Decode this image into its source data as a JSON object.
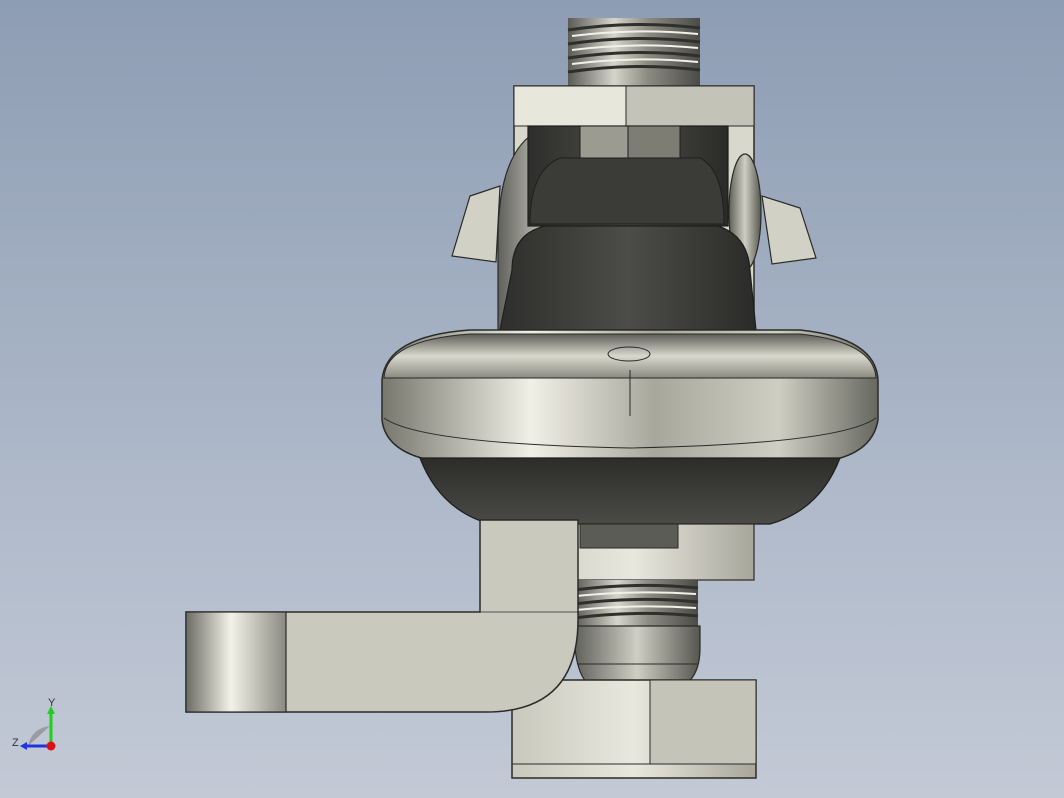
{
  "viewport": {
    "background_top": "#8e9db4",
    "background_bottom": "#c3cad6"
  },
  "triad": {
    "x_label": "",
    "y_label": "Y",
    "z_label": "Z",
    "y_color": "#22cc22",
    "z_color": "#2233dd",
    "x_color": "#dd1111"
  },
  "model": {
    "metal_light": "#e8e6da",
    "metal_mid": "#a9a89c",
    "metal_dark": "#3e3f3b"
  }
}
